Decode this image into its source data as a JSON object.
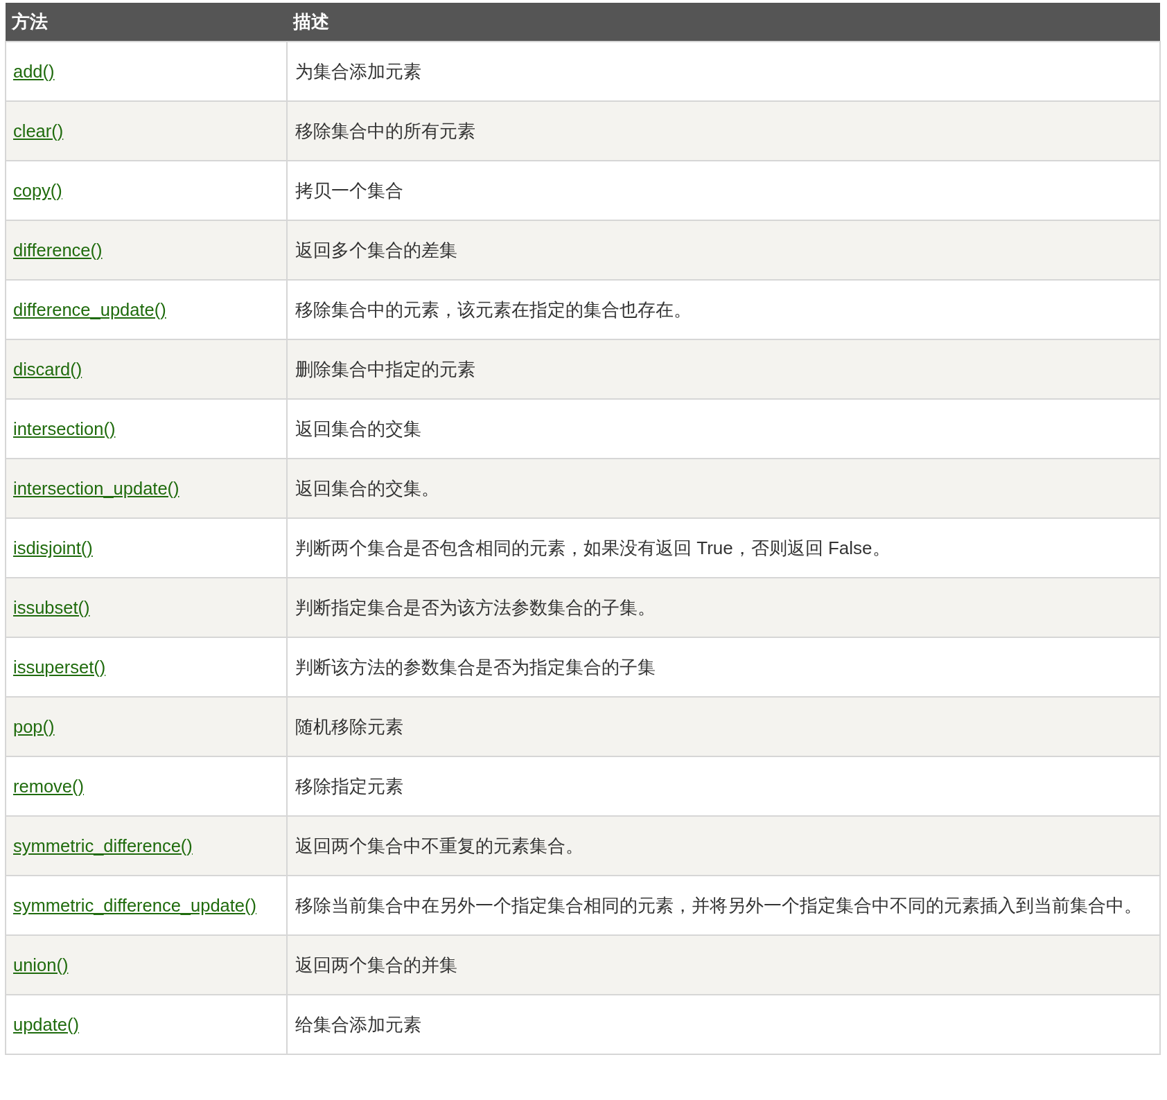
{
  "table": {
    "columns": [
      "方法",
      "描述"
    ],
    "rows": [
      {
        "method": "add()",
        "description": "为集合添加元素"
      },
      {
        "method": "clear()",
        "description": "移除集合中的所有元素"
      },
      {
        "method": "copy()",
        "description": "拷贝一个集合"
      },
      {
        "method": "difference()",
        "description": "返回多个集合的差集"
      },
      {
        "method": "difference_update()",
        "description": "移除集合中的元素，该元素在指定的集合也存在。"
      },
      {
        "method": "discard()",
        "description": "删除集合中指定的元素"
      },
      {
        "method": "intersection()",
        "description": "返回集合的交集"
      },
      {
        "method": "intersection_update()",
        "description": "返回集合的交集。"
      },
      {
        "method": "isdisjoint()",
        "description": "判断两个集合是否包含相同的元素，如果没有返回 True，否则返回 False。"
      },
      {
        "method": "issubset()",
        "description": "判断指定集合是否为该方法参数集合的子集。"
      },
      {
        "method": "issuperset()",
        "description": "判断该方法的参数集合是否为指定集合的子集"
      },
      {
        "method": "pop()",
        "description": "随机移除元素"
      },
      {
        "method": "remove()",
        "description": "移除指定元素"
      },
      {
        "method": "symmetric_difference()",
        "description": "返回两个集合中不重复的元素集合。"
      },
      {
        "method": "symmetric_difference_update()",
        "description": "移除当前集合中在另外一个指定集合相同的元素，并将另外一个指定集合中不同的元素插入到当前集合中。"
      },
      {
        "method": "union()",
        "description": "返回两个集合的并集"
      },
      {
        "method": "update()",
        "description": "给集合添加元素"
      }
    ]
  }
}
